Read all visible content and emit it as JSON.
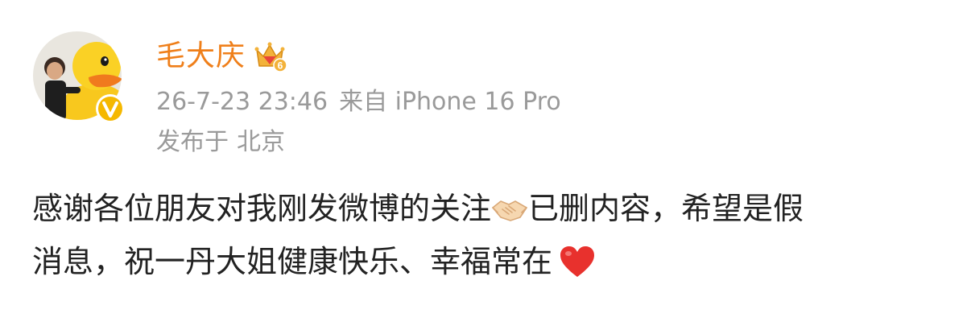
{
  "post": {
    "username": "毛大庆",
    "timestamp": "26-7-23 23:46",
    "source": "来自 iPhone 16 Pro",
    "location_prefix": "发布于",
    "location": "北京",
    "content": {
      "line1_a": "感谢各位朋友对我刚发微博的关注",
      "line1_b": "已删内容，希望是假",
      "line2": "消息，祝一丹大姐健康快乐、幸福常在"
    }
  },
  "icons": {
    "vip_badge": "crown-level-6-icon",
    "verified": "verified-v-icon",
    "handshake": "handshake-emoji",
    "heart": "red-heart-emoji"
  },
  "colors": {
    "username": "#ef7f1a",
    "meta_text": "#9a9a9a",
    "body_text": "#222222",
    "verified_badge": "#f5b800",
    "heart": "#e8312d"
  }
}
